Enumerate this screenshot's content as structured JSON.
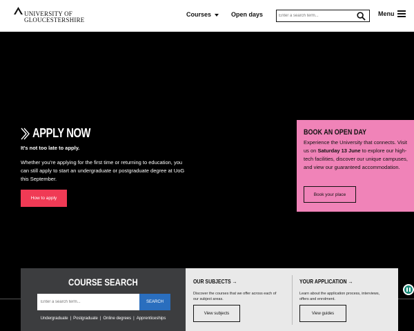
{
  "header": {
    "logo_line1": "UNIVERSITY OF",
    "logo_line2": "GLOUCESTERSHIRE",
    "nav_courses": "Courses",
    "nav_open_days": "Open days",
    "search_placeholder": "Enter a search term...",
    "menu_label": "Menu"
  },
  "hero": {
    "apply_title": "APPLY NOW",
    "apply_subtitle": "It's not too late to apply.",
    "apply_body": "Whether you're applying for the first time or returning to education, you can still apply to start an undergraduate or postgraduate degree at UoG this September.",
    "apply_button": "How to apply"
  },
  "open_day": {
    "title": "BOOK AN OPEN DAY",
    "text_before": "Experience the University that connects. Visit us on ",
    "text_bold": "Saturday 13 June",
    "text_after": " to explore our high-tech facilities, discover our unique campuses, and view our guaranteed accommodation.",
    "button": "Book your place",
    "bg_color": "#f083b8"
  },
  "course_search": {
    "title": "COURSE SEARCH",
    "placeholder": "Enter a search term...",
    "button": "SEARCH",
    "links": [
      "Undergraduate",
      "Postgraduate",
      "Online degrees",
      "Apprenticeships"
    ],
    "separator": "|"
  },
  "our_subjects": {
    "title": "OUR SUBJECTS →",
    "text": "Discover the courses that we offer across each of our subject areas.",
    "button": "View subjects"
  },
  "your_application": {
    "title": "YOUR APPLICATION →",
    "text": "Learn about the application process, interviews, offers and enrolment.",
    "button": "View guides"
  },
  "colors": {
    "apply_button": "#f03a55",
    "search_button": "#2a6ebe",
    "pause_button": "#1a8a78"
  }
}
